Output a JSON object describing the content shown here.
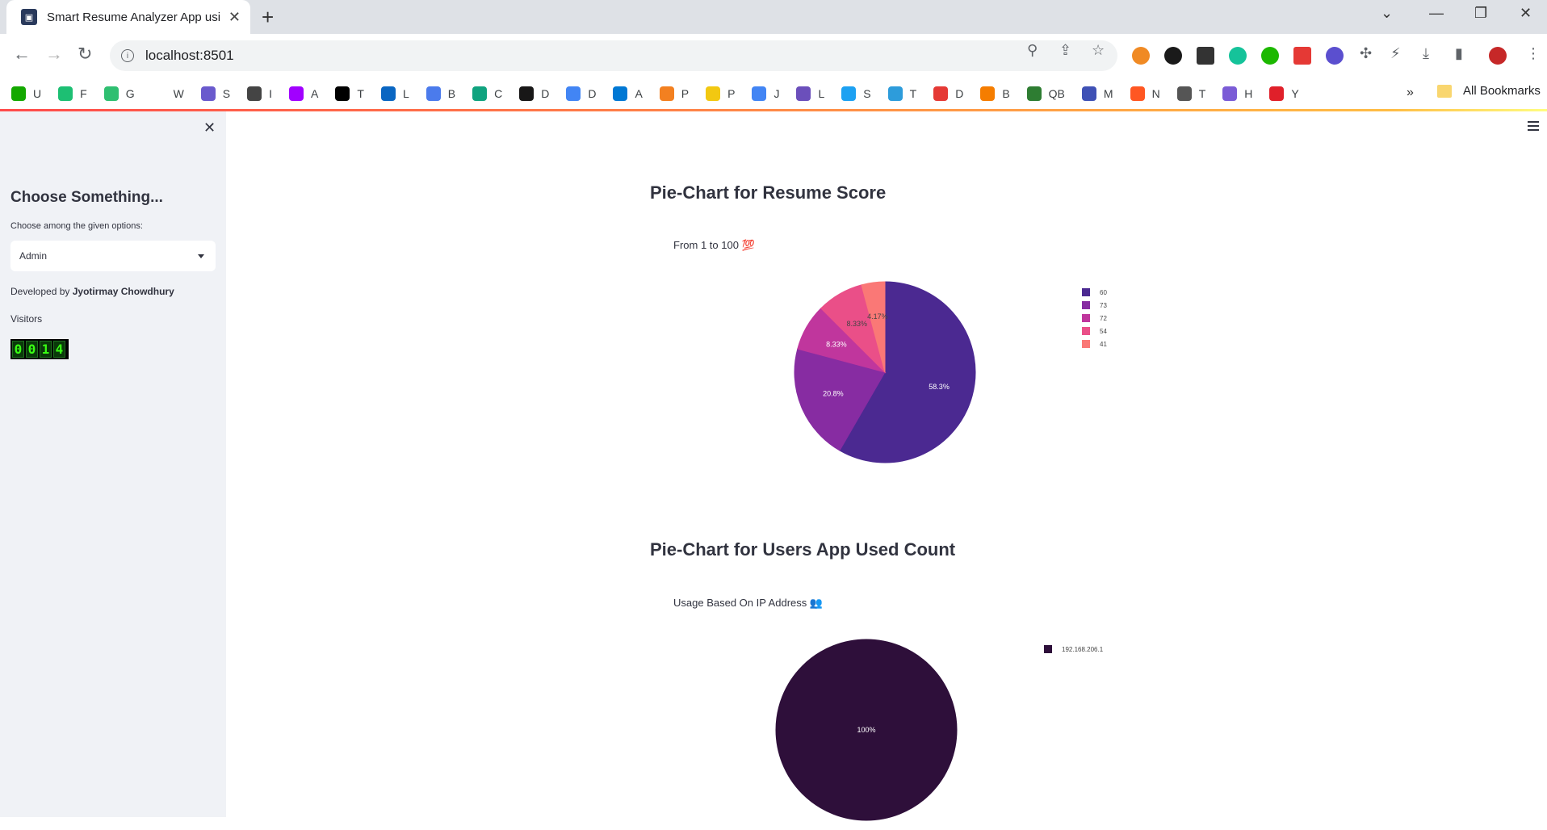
{
  "browser": {
    "tab_title": "Smart Resume Analyzer App usi",
    "url": "localhost:8501",
    "bookmarks": [
      {
        "label": "U",
        "color": "#14a800"
      },
      {
        "label": "F",
        "color": "#1dbf73"
      },
      {
        "label": "G",
        "color": "#2fbf71"
      },
      {
        "label": "W",
        "color": "#ffffff"
      },
      {
        "label": "S",
        "color": "#6a5acd"
      },
      {
        "label": "I",
        "color": "#444444"
      },
      {
        "label": "A",
        "color": "#a100ff"
      },
      {
        "label": "T",
        "color": "#000000"
      },
      {
        "label": "L",
        "color": "#0a66c2"
      },
      {
        "label": "B",
        "color": "#4b7bec"
      },
      {
        "label": "C",
        "color": "#10a37f"
      },
      {
        "label": "D",
        "color": "#181717"
      },
      {
        "label": "D",
        "color": "#4285f4"
      },
      {
        "label": "A",
        "color": "#0078d4"
      },
      {
        "label": "P",
        "color": "#f38020"
      },
      {
        "label": "P",
        "color": "#f2c811"
      },
      {
        "label": "J",
        "color": "#4285f4"
      },
      {
        "label": "L",
        "color": "#6b4fbb"
      },
      {
        "label": "S",
        "color": "#1da1f2"
      },
      {
        "label": "T",
        "color": "#2d9cdb"
      },
      {
        "label": "D",
        "color": "#e53935"
      },
      {
        "label": "B",
        "color": "#f57d00"
      },
      {
        "label": "QB",
        "color": "#2e7d32"
      },
      {
        "label": "M",
        "color": "#3f51b5"
      },
      {
        "label": "N",
        "color": "#ff5722"
      },
      {
        "label": "T",
        "color": "#555555"
      },
      {
        "label": "H",
        "color": "#7b5cd6"
      },
      {
        "label": "Y",
        "color": "#e0202a"
      }
    ],
    "all_bookmarks": "All Bookmarks",
    "more": "»"
  },
  "sidebar": {
    "heading": "Choose Something...",
    "select_label": "Choose among the given options:",
    "select_value": "Admin",
    "developed_prefix": "Developed by",
    "developer": "Jyotirmay Chowdhury",
    "visitors_label": "Visitors",
    "visitor_digits": [
      "0",
      "0",
      "1",
      "4"
    ]
  },
  "main": {
    "section1_title": "Pie-Chart for Resume Score",
    "section1_caption": "From 1 to 100 💯",
    "section2_title": "Pie-Chart for Users App Used Count",
    "section2_caption": "Usage Based On IP Address 👥"
  },
  "chart_data": [
    {
      "type": "pie",
      "labels": [
        "60",
        "73",
        "72",
        "54",
        "41"
      ],
      "percent_labels": [
        "58.3%",
        "20.8%",
        "8.33%",
        "8.33%",
        "4.17%"
      ],
      "values": [
        58.3,
        20.8,
        8.33,
        8.33,
        4.17
      ],
      "colors": [
        "#4b2991",
        "#872ca2",
        "#c0369d",
        "#ea4f88",
        "#fa7876"
      ],
      "legend_position": "right"
    },
    {
      "type": "pie",
      "labels": [
        "192.168.206.1"
      ],
      "percent_labels": [
        "100%"
      ],
      "values": [
        100
      ],
      "colors": [
        "#2e0f3a"
      ],
      "legend_position": "right"
    }
  ]
}
